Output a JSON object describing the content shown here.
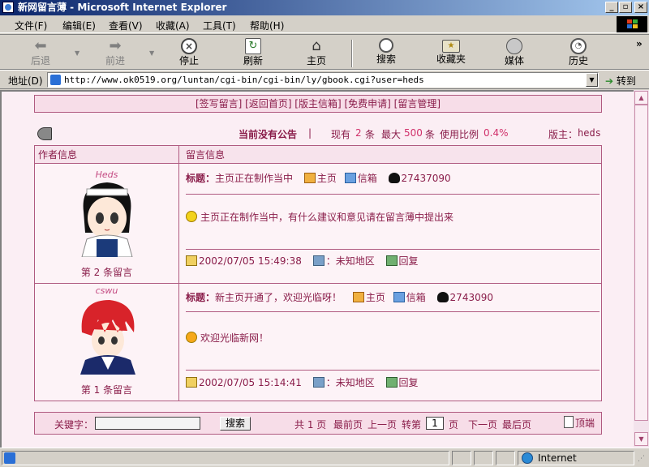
{
  "window": {
    "title": "新网留言薄 - Microsoft Internet Explorer"
  },
  "menu": [
    "文件(F)",
    "编辑(E)",
    "查看(V)",
    "收藏(A)",
    "工具(T)",
    "帮助(H)"
  ],
  "toolbar": {
    "back": "后退",
    "forward": "前进",
    "stop": "停止",
    "refresh": "刷新",
    "home": "主页",
    "search": "搜索",
    "favorites": "收藏夹",
    "media": "媒体",
    "history": "历史",
    "more": "»"
  },
  "address": {
    "label": "地址(D)",
    "url": "http://www.ok0519.org/luntan/cgi-bin/cgi-bin/ly/gbook.cgi?user=heds",
    "go": "转到"
  },
  "page": {
    "topmenu": "[签写留言] [返回首页] [版主信箱] [免费申请] [留言管理]",
    "announcement": "当前没有公告",
    "stats": {
      "sep": "|",
      "prefix": "现有",
      "count": "2",
      "unit1": "条",
      "max_label": "最大",
      "max": "500",
      "unit2": "条",
      "ratio_label": "使用比例",
      "ratio": "0.4%"
    },
    "admin_label": "版主：",
    "admin": "heds",
    "headers": {
      "author": "作者信息",
      "message": "留言信息"
    },
    "entries": [
      {
        "name": "Heds",
        "num_label": "第 2 条留言",
        "title_label": "标题：",
        "title": "主页正在制作当中",
        "home": "主页",
        "mail": "信箱",
        "qq": "27437090",
        "body": "主页正在制作当中，有什么建议和意见请在留言薄中提出来",
        "time": "2002/07/05 15:49:38",
        "location": "：未知地区",
        "reply": "回复"
      },
      {
        "name": "cswu",
        "num_label": "第 1 条留言",
        "title_label": "标题：",
        "title": "新主页开通了，欢迎光临呀！",
        "home": "主页",
        "mail": "信箱",
        "qq": "2743090",
        "body": "欢迎光临新网！",
        "time": "2002/07/05 15:14:41",
        "location": "：未知地区",
        "reply": "回复"
      }
    ],
    "bottom": {
      "keyword_label": "关键字：",
      "keyword_value": "",
      "search_button": "搜索",
      "total": "共 1 页",
      "first": "最前页",
      "prev": "上一页",
      "goto": "转第",
      "page_value": "1",
      "page_unit": "页",
      "next": "下一页",
      "last": "最后页",
      "top": "顶端"
    }
  },
  "status": {
    "zone": "Internet"
  }
}
